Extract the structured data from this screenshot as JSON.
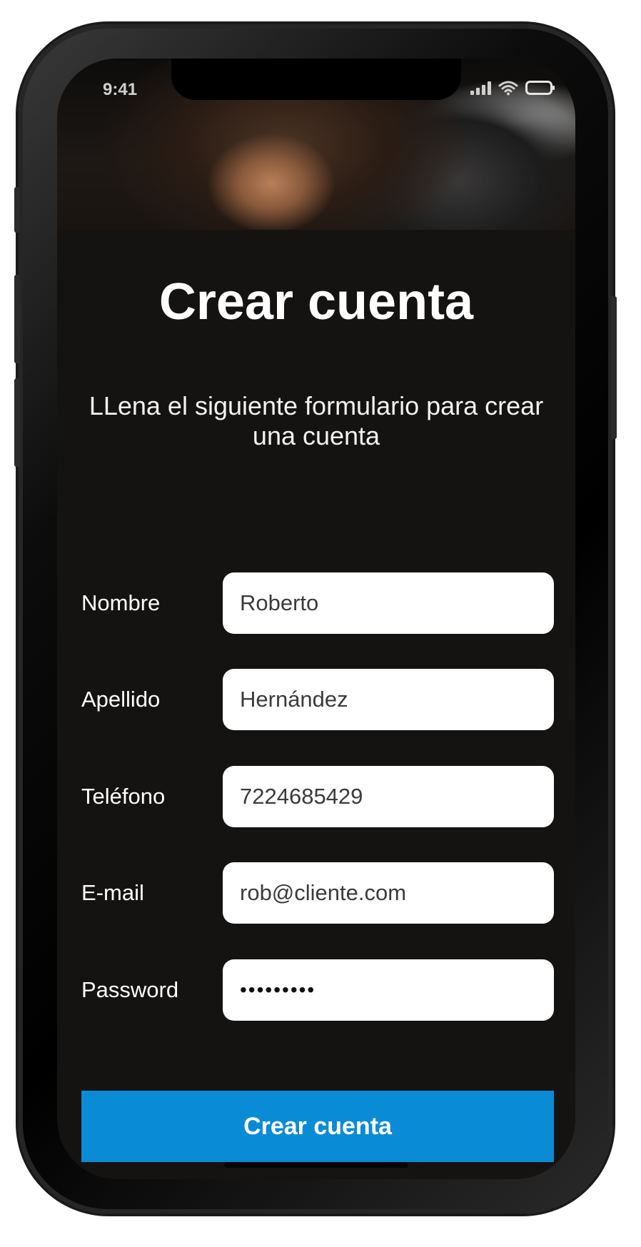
{
  "status_bar": {
    "time": "9:41",
    "icons": [
      "signal-icon",
      "wifi-icon",
      "battery-icon"
    ]
  },
  "hero": {
    "image": "barber-client-photo"
  },
  "header": {
    "title": "Crear cuenta",
    "subtitle": "LLena el siguiente formulario para crear una cuenta"
  },
  "form": {
    "fields": [
      {
        "label": "Nombre",
        "value": "Roberto"
      },
      {
        "label": "Apellido",
        "value": "Hernández"
      },
      {
        "label": "Teléfono",
        "value": "7224685429"
      },
      {
        "label": "E-mail",
        "value": "rob@cliente.com"
      },
      {
        "label": "Password",
        "value": "•••••••••"
      }
    ],
    "submit_label": "Crear cuenta"
  },
  "colors": {
    "background": "#141311",
    "accent": "#0a8bd6",
    "input_bg": "#ffffff"
  }
}
